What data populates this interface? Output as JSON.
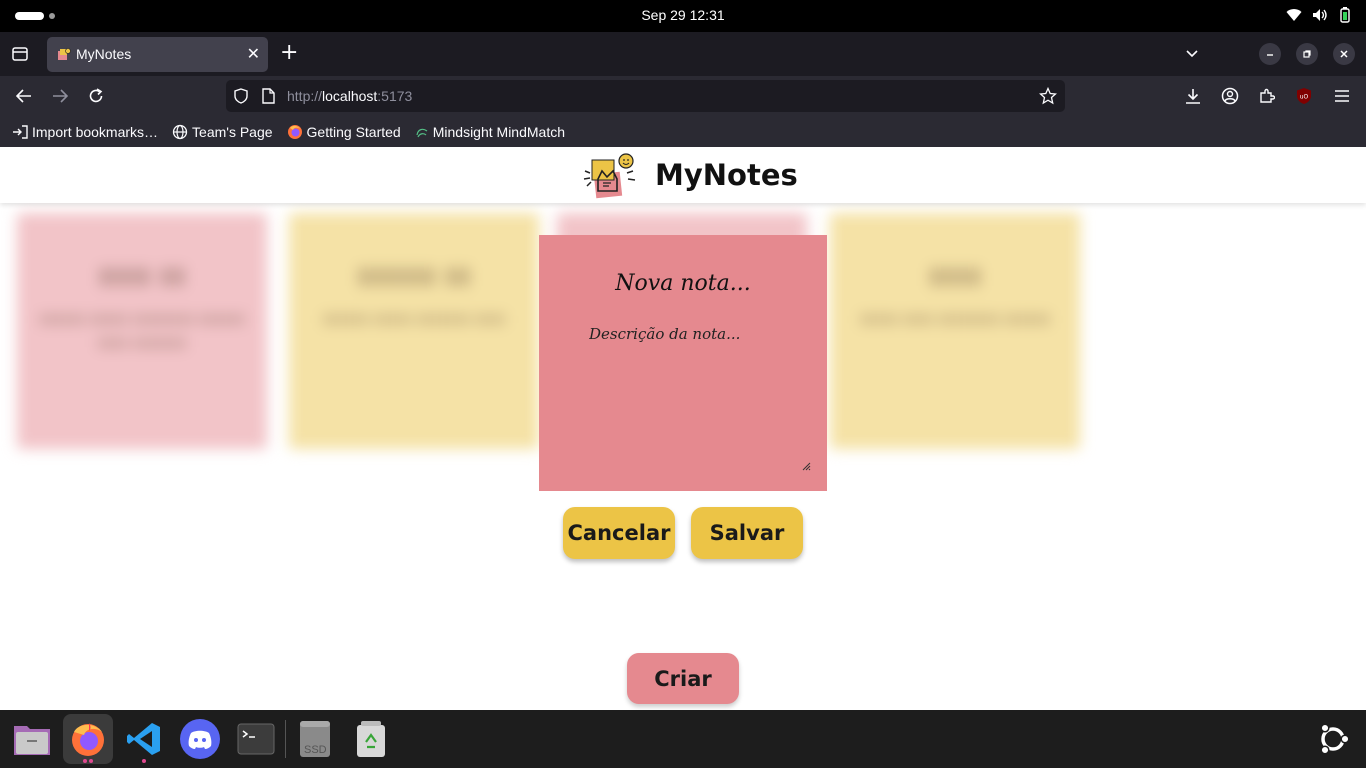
{
  "system_bar": {
    "clock": "Sep 29  12:31"
  },
  "browser": {
    "tab": {
      "title": "MyNotes"
    },
    "url": {
      "scheme": "http://",
      "host": "localhost",
      "port": ":5173"
    },
    "bookmarks": [
      {
        "label": "Import bookmarks…",
        "icon": "import-icon"
      },
      {
        "label": "Team's Page",
        "icon": "globe-icon"
      },
      {
        "label": "Getting Started",
        "icon": "firefox-icon"
      },
      {
        "label": "Mindsight MindMatch",
        "icon": "mindsight-icon"
      }
    ]
  },
  "app": {
    "title": "MyNotes",
    "new_note": {
      "title_placeholder": "Nova nota...",
      "description_placeholder": "Descrição da nota...",
      "color": "#e5898f"
    },
    "buttons": {
      "cancel": "Cancelar",
      "save": "Salvar",
      "create": "Criar"
    },
    "colors": {
      "accent_yellow": "#ecc446",
      "note_pink": "#e5898f"
    }
  },
  "dock": {
    "items": [
      "files-icon",
      "firefox-icon",
      "vscode-icon",
      "discord-icon",
      "terminal-icon",
      "ssd-drive-icon",
      "trash-icon"
    ],
    "ssd_label": "SSD"
  }
}
